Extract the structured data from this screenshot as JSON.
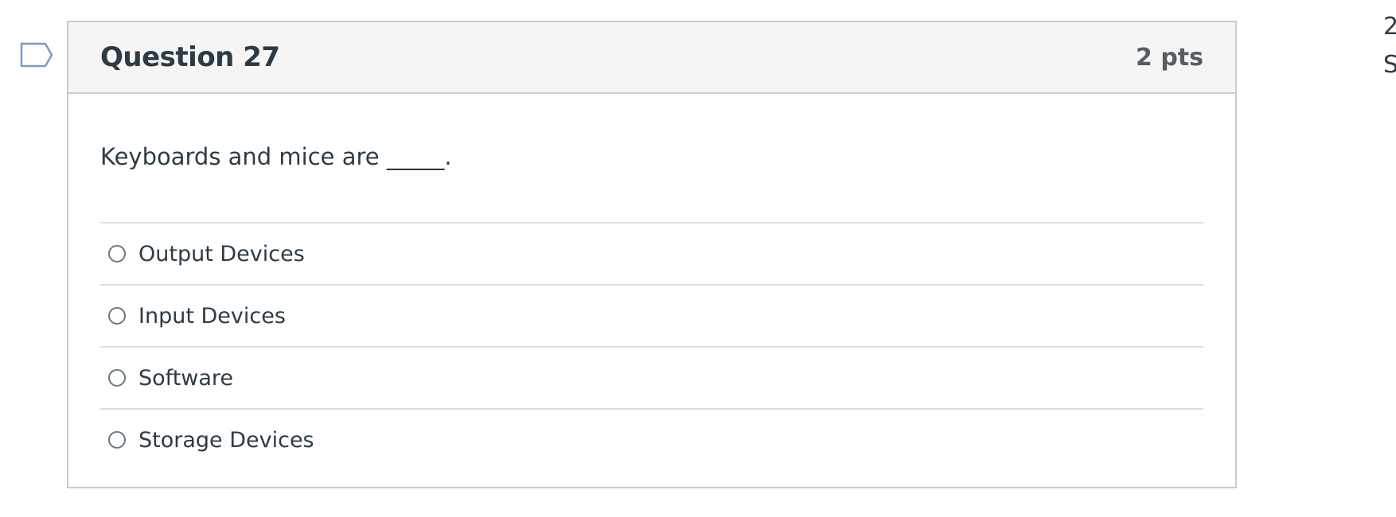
{
  "question": {
    "title": "Question 27",
    "points": "2 pts",
    "text": "Keyboards and mice are _____.",
    "answers": [
      {
        "label": "Output Devices",
        "selected": false
      },
      {
        "label": "Input Devices",
        "selected": false
      },
      {
        "label": "Software",
        "selected": false
      },
      {
        "label": "Storage Devices",
        "selected": false
      }
    ]
  },
  "sidebar_clip": {
    "line1": "2",
    "line2": "S"
  },
  "colors": {
    "flag_outline": "#7a9cc6",
    "header_bg": "#f5f5f5",
    "border": "#c7cdd1",
    "text": "#2d3b45"
  },
  "icons": {
    "flag": "flag-question-icon",
    "radio": "radio-unchecked-icon"
  }
}
